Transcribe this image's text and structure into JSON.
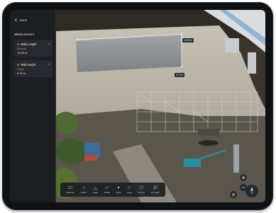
{
  "nav": {
    "back_label": "Back"
  },
  "sidebar": {
    "section_title": "Measurement",
    "section_menu": "...",
    "cards": [
      {
        "title": "Wall Length",
        "label": "Distance",
        "value": "14.66 m",
        "color": "#e23b3b"
      },
      {
        "title": "Wall Height",
        "label": "Height",
        "value": "5.79 m",
        "color": "#e23b3b"
      }
    ]
  },
  "scene": {
    "length_tag": "14.66 m",
    "height_tag": "5.79 m"
  },
  "toolbar": {
    "tools": [
      {
        "label": "Distance",
        "icon": "ruler-icon"
      },
      {
        "label": "Height",
        "icon": "height-icon"
      },
      {
        "label": "Angle",
        "icon": "angle-icon"
      },
      {
        "label": "Profile",
        "icon": "profile-icon"
      },
      {
        "label": "Point",
        "icon": "point-icon"
      },
      {
        "label": "Area",
        "icon": "area-icon"
      },
      {
        "label": "Volume",
        "icon": "volume-icon"
      },
      {
        "label": "Annotate",
        "icon": "annotate-icon"
      }
    ]
  }
}
